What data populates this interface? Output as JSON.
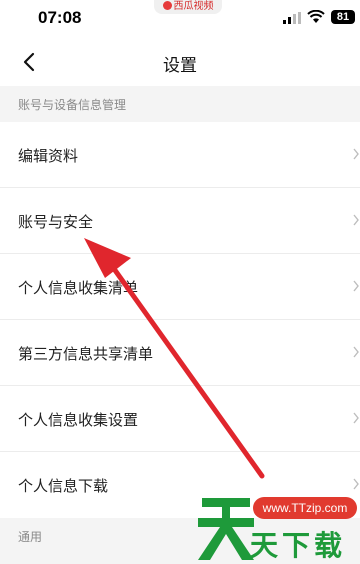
{
  "status_bar": {
    "time": "07:08",
    "app_indicator": "西瓜视频",
    "battery": "81",
    "icons": [
      "signal-icon",
      "wifi-icon",
      "battery-icon"
    ]
  },
  "nav": {
    "title": "设置",
    "back_icon": "chevron-left-icon"
  },
  "sections": {
    "account": {
      "header": "账号与设备信息管理"
    },
    "general": {
      "header": "通用"
    }
  },
  "list_items": [
    {
      "label": "编辑资料"
    },
    {
      "label": "账号与安全"
    },
    {
      "label": "个人信息收集清单"
    },
    {
      "label": "第三方信息共享清单"
    },
    {
      "label": "个人信息收集设置"
    },
    {
      "label": "个人信息下载"
    }
  ],
  "annotation": {
    "color": "#e0262d",
    "points_to": "账号与安全"
  },
  "watermark": {
    "url": "www.TTzip.com",
    "logo_char": "天",
    "text": "天下载",
    "brand_color": "#1e9a3a",
    "badge_color": "#e13a2f"
  }
}
